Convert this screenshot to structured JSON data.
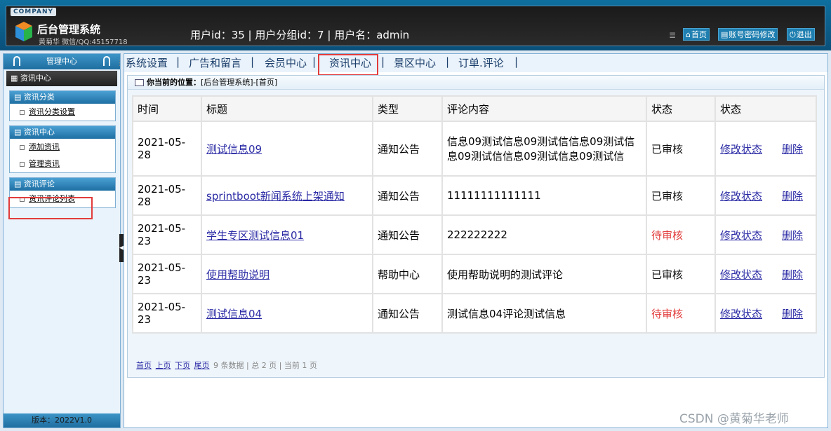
{
  "header": {
    "company_badge": "COMPANY",
    "title": "后台管理系统",
    "subtitle": "黄菊华 微信/QQ:45157718",
    "user_info": "用户id：35 | 用户分组id：7 | 用户名：admin",
    "home_label": "首页",
    "password_label": "账号密码修改",
    "logout_label": "退出"
  },
  "sidebar": {
    "head": "管理中心",
    "current": "资讯中心",
    "groups": [
      {
        "title": "资讯分类",
        "items": [
          "资讯分类设置"
        ]
      },
      {
        "title": "资讯中心",
        "items": [
          "添加资讯",
          "管理资讯"
        ]
      },
      {
        "title": "资讯评论",
        "items": [
          "资讯评论列表"
        ]
      }
    ],
    "version": "版本：2022V1.0"
  },
  "nav": {
    "items": [
      "系统设置",
      "广告和留言",
      "会员中心",
      "资讯中心",
      "景区中心",
      "订单.评论"
    ],
    "separator": "|",
    "active_index": 3
  },
  "breadcrumb": {
    "label": "你当前的位置：",
    "path": "[后台管理系统]-[首页]"
  },
  "table": {
    "headers": [
      "时间",
      "标题",
      "类型",
      "评论内容",
      "状态",
      "状态"
    ],
    "rows": [
      {
        "time": "2021-05-28",
        "title": "测试信息09",
        "type": "通知公告",
        "content": "信息09测试信息09测试信信息09测试信息09测试信信息09测试信息09测试信",
        "status": "已审核",
        "status_kind": "ok",
        "edit": "修改状态",
        "del": "删除"
      },
      {
        "time": "2021-05-28",
        "title": "sprintboot新闻系统上架通知",
        "type": "通知公告",
        "content": "11111111111111",
        "status": "已审核",
        "status_kind": "ok",
        "edit": "修改状态",
        "del": "删除"
      },
      {
        "time": "2021-05-23",
        "title": "学生专区测试信息01",
        "type": "通知公告",
        "content": "222222222",
        "status": "待审核",
        "status_kind": "wait",
        "edit": "修改状态",
        "del": "删除"
      },
      {
        "time": "2021-05-23",
        "title": "使用帮助说明",
        "type": "帮助中心",
        "content": "使用帮助说明的测试评论",
        "status": "已审核",
        "status_kind": "ok",
        "edit": "修改状态",
        "del": "删除"
      },
      {
        "time": "2021-05-23",
        "title": "测试信息04",
        "type": "通知公告",
        "content": "测试信息04评论测试信息",
        "status": "待审核",
        "status_kind": "wait",
        "edit": "修改状态",
        "del": "删除"
      }
    ]
  },
  "pager": {
    "first": "首页",
    "prev": "上页",
    "next": "下页",
    "last": "尾页",
    "summary": "9 条数据 | 总 2 页 | 当前 1 页"
  },
  "watermark": "CSDN @黄菊华老师",
  "colors": {
    "pending": "#e23b3b",
    "link": "#2a2aa5",
    "highlight": "#e23c3c"
  }
}
